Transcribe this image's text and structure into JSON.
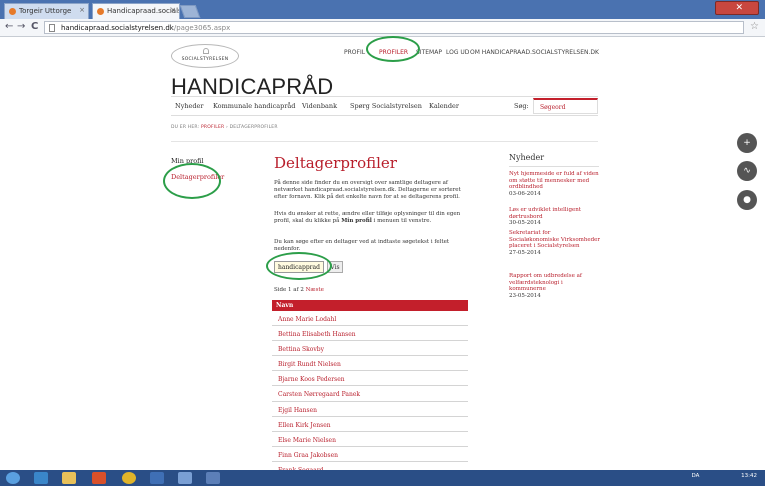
{
  "browser": {
    "tabs": [
      {
        "label": "Torgeir Uttorge"
      },
      {
        "label": "Handicapraad.socialstyrel"
      }
    ],
    "nav": {
      "back": "←",
      "forward": "→",
      "reload": "C"
    },
    "url": "handicapraad.socialstyrelsen.dk/page3065.aspx",
    "url_host": "handicapraad.socialstyrelsen.dk",
    "url_path": "/page3065.aspx"
  },
  "site": {
    "logo_text": "SOCIALSTYRELSEN",
    "title": "HANDICAPRÅD",
    "top_nav": [
      "PROFIL",
      "PROFILER",
      "SITEMAP",
      "LOG UD",
      "OM HANDICAPRAAD.SOCIALSTYRELSEN.DK"
    ],
    "top_nav_active": 1,
    "main_nav": [
      "Nyheder",
      "Kommunale handicapråd",
      "Videnbank",
      "Spørg Socialstyrelsen",
      "Kalender"
    ],
    "search_label": "Søg:",
    "search_value": "Søgeord",
    "breadcrumb_prefix": "DU ER HER:",
    "breadcrumb_link": "PROFILER",
    "breadcrumb_sep": "›",
    "breadcrumb_current": "DELTAGERPROFILER"
  },
  "left": {
    "my_profile": "Min profil",
    "deltager": "Deltagerprofiler"
  },
  "main": {
    "heading": "Deltagerprofiler",
    "intro1": "På denne side finder du en oversigt over samtlige deltagere af netværket handicapraad.socialstyrelsen.dk. Deltagerne er sorteret efter fornavn. Klik på det enkelte navn for at se deltagerens profil.",
    "intro2_a": "Hvis du ønsker at rette, ændre eller tilføje oplysninger til din egen profil, skal du klikke på ",
    "intro2_b": "Min profil",
    "intro2_c": " i menuen til venstre.",
    "intro3": "Du kan søge efter en deltager ved at indtaste søgetekst i feltet nedenfor.",
    "search_value": "handicapprad",
    "go_label": "Vis",
    "pager_a": "Side 1 af 2 ",
    "pager_next": "Næste",
    "table_header": "Navn",
    "rows": [
      "Anne Marie Lodahl",
      "Bettina Elisabeth Hansen",
      "Bettina Skovby",
      "Birgit Rundt Nielsen",
      "Bjarne Koos Pedersen",
      "Carsten Nørregaard Panek",
      "Ejgil Hansen",
      "Ellen Kirk Jensen",
      "Else Marie Nielsen",
      "Finn Graa Jakobsen",
      "Frank Sogaard"
    ]
  },
  "news": {
    "heading": "Nyheder",
    "items": [
      {
        "title": "Nyt hjemmeside er fuld af viden om støtte til mennesker med ordblindhed",
        "date": "03-06-2014"
      },
      {
        "title": "Løs er udviklet intelligent dørtrusbord",
        "date": "30-05-2014"
      },
      {
        "title": "Sekretariat for Socialøkonomiske Virksomheder placeret i Socialstyrelsen",
        "date": "27-05-2014"
      },
      {
        "title": "Rapport om udbredelse af velfærdsteknologi i kommunerne",
        "date": "23-05-2014"
      }
    ]
  },
  "social_icons": [
    "share-icon",
    "rss-icon",
    "user-icon"
  ],
  "taskbar": {
    "lang": "DA",
    "time": "13:42",
    "date": "05-06-2014"
  },
  "colors": {
    "brand_red": "#c31f2b",
    "oval_green": "#2c9e49",
    "taskbar": "#2a4e86"
  }
}
